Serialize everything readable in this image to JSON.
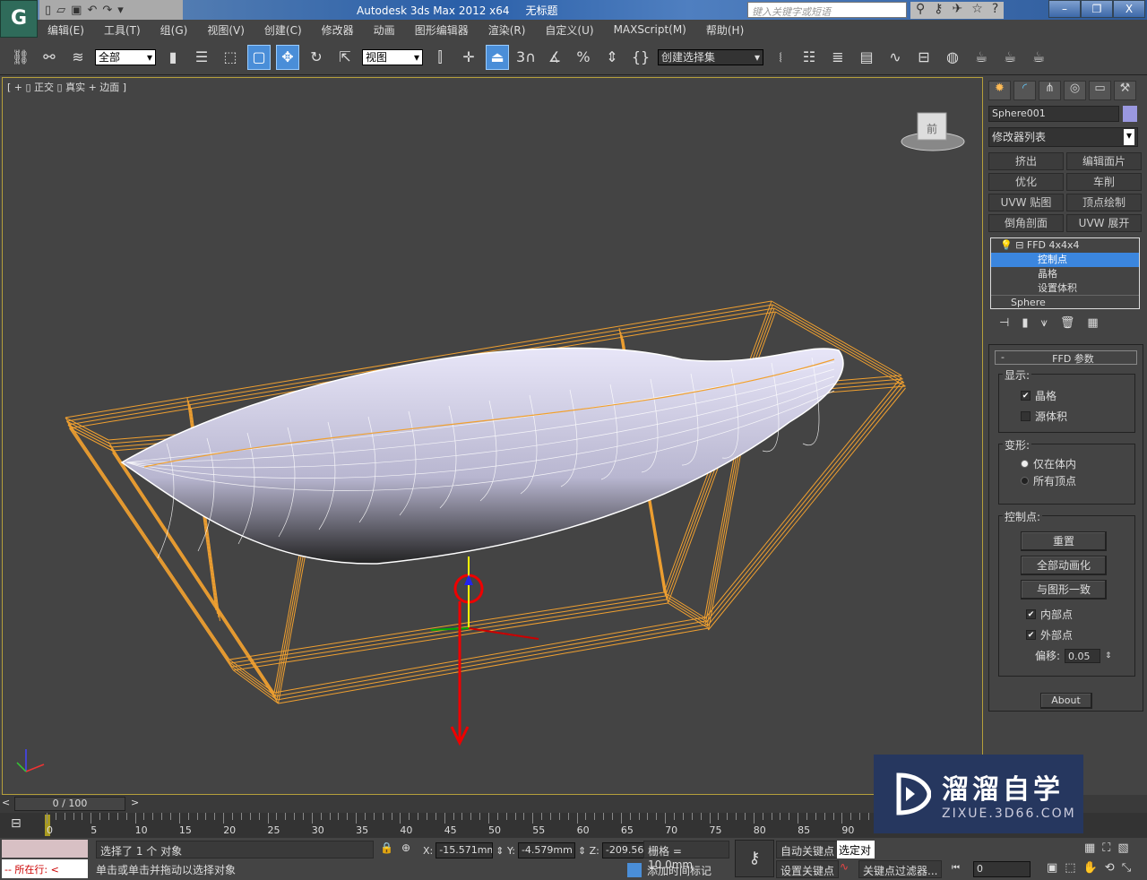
{
  "app": {
    "logo": "3ds-max-logo",
    "title": "Autodesk 3ds Max  2012 x64",
    "doc": "无标题",
    "search_placeholder": "键入关键字或短语"
  },
  "menu": [
    "编辑(E)",
    "工具(T)",
    "组(G)",
    "视图(V)",
    "创建(C)",
    "修改器",
    "动画",
    "图形编辑器",
    "渲染(R)",
    "自定义(U)",
    "MAXScript(M)",
    "帮助(H)"
  ],
  "toolbar": {
    "selection_filter": "全部",
    "ref_coord": "视图",
    "snap_label": "3",
    "named_selection": "创建选择集"
  },
  "viewport": {
    "label": "[ + ▯ 正交 ▯ 真实 + 边面 ]",
    "viewcube_label": "前",
    "accent": "#f0a030"
  },
  "panel": {
    "object_name": "Sphere001",
    "object_color": "#9a98e0",
    "modifier_list": "修改器列表",
    "modifier_buttons": [
      "挤出",
      "编辑面片",
      "优化",
      "车削",
      "UVW 贴图",
      "顶点绘制",
      "倒角剖面",
      "UVW 展开"
    ],
    "stack": {
      "modifier": "FFD 4x4x4",
      "sub": [
        "控制点",
        "晶格",
        "设置体积"
      ],
      "base": "Sphere"
    },
    "rollout_title": "FFD 参数",
    "display": {
      "label": "显示:",
      "lattice": "晶格",
      "lattice_checked": true,
      "source": "源体积",
      "source_checked": false
    },
    "deform": {
      "label": "变形:",
      "inside": "仅在体内",
      "all": "所有顶点",
      "selected": "仅在体内"
    },
    "cp": {
      "label": "控制点:",
      "reset": "重置",
      "animate_all": "全部动画化",
      "conform": "与图形一致",
      "inside": "内部点",
      "inside_checked": true,
      "outside": "外部点",
      "outside_checked": true,
      "offset_label": "偏移:",
      "offset": "0.05"
    },
    "about": "About"
  },
  "timeline": {
    "position": "0 / 100",
    "current_frame": 0,
    "ticks": [
      "0",
      "5",
      "10",
      "15",
      "20",
      "25",
      "30",
      "35",
      "40",
      "45",
      "50",
      "55",
      "60",
      "65",
      "70",
      "75",
      "80",
      "85",
      "90"
    ]
  },
  "status": {
    "line1": "选择了 1 个 对象",
    "line2": "单击或单击并拖动以选择对象",
    "maxscript": "--  所在行:  <",
    "x": "-15.571mm",
    "y": "-4.579mm",
    "z": "-209.567mm",
    "grid": "栅格 = 10.0mm",
    "auto_key": "自动关键点",
    "set_key": "设置关键点",
    "selected": "选定对",
    "key_filters": "关键点过滤器...",
    "add_time_tag": "添加时间标记",
    "frame": "0"
  },
  "watermark": {
    "name": "溜溜自学",
    "url": "ZIXUE.3D66.COM"
  }
}
